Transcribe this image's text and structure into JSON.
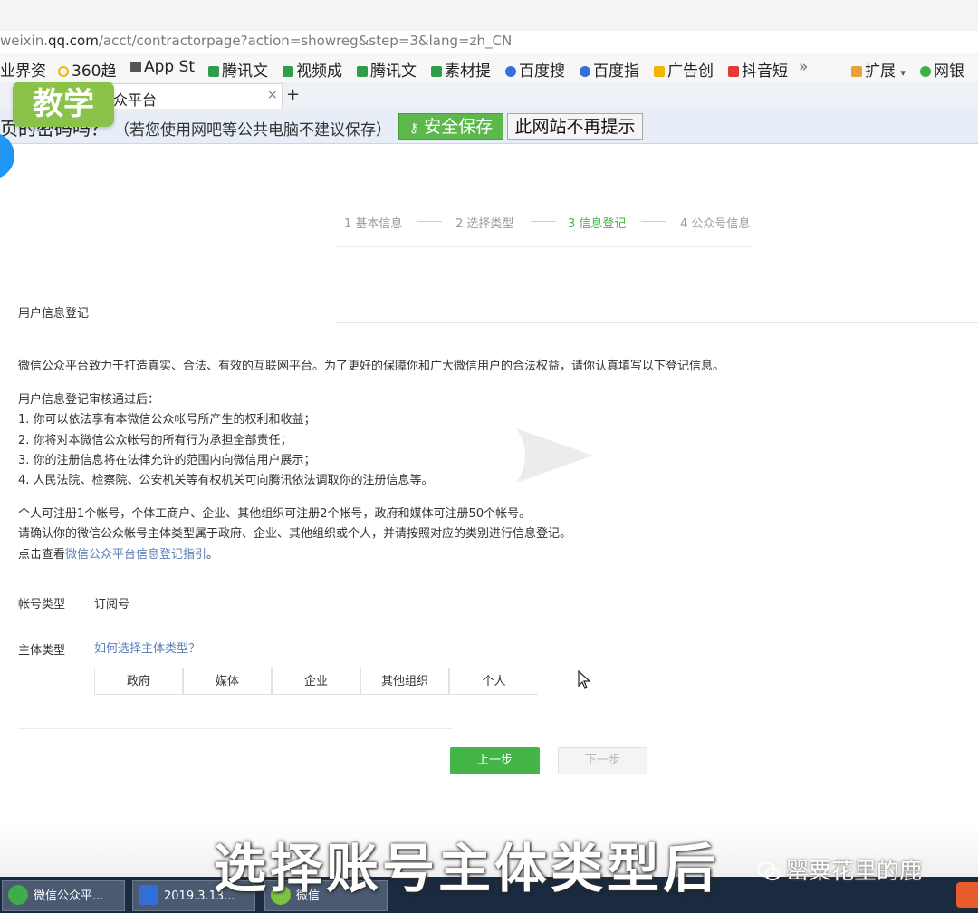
{
  "browser": {
    "url_prefix": "weixin.",
    "url_domain": "qq.com",
    "url_path": "/acct/contractorpage?action=showreg&step=3&lang=zh_CN",
    "bookmarks": [
      {
        "label": "业界资",
        "icon": "folder-icon",
        "color": "#f5b400"
      },
      {
        "label": "360趋",
        "icon": "360-icon",
        "color": "#f5b400"
      },
      {
        "label": "App St",
        "icon": "app-icon",
        "color": "#555555"
      },
      {
        "label": "腾讯文",
        "icon": "doc-icon",
        "color": "#2e9e4a"
      },
      {
        "label": "视频成",
        "icon": "doc-icon",
        "color": "#2e9e4a"
      },
      {
        "label": "腾讯文",
        "icon": "doc-icon",
        "color": "#2e9e4a"
      },
      {
        "label": "素材提",
        "icon": "doc-icon",
        "color": "#2e9e4a"
      },
      {
        "label": "百度搜",
        "icon": "baidu-icon",
        "color": "#3a6fd8"
      },
      {
        "label": "百度指",
        "icon": "baidu-icon",
        "color": "#3a6fd8"
      },
      {
        "label": "广告创",
        "icon": "folder-icon",
        "color": "#f5b400"
      },
      {
        "label": "抖音短",
        "icon": "folder-icon",
        "color": "#e53935"
      }
    ],
    "bookmarks_more": "»",
    "extensions_label": "扩展",
    "bank_label": "网银",
    "tab_title": "众平台",
    "tab_close": "×",
    "tab_add": "+"
  },
  "badge": {
    "label": "教学"
  },
  "password_bar": {
    "question": "页的密码吗？",
    "note": "（若您使用网吧等公共电脑不建议保存）",
    "save_label": "安全保存",
    "never_label": "此网站不再提示"
  },
  "steps": [
    {
      "label": "1 基本信息",
      "active": false
    },
    {
      "label": "2 选择类型",
      "active": false
    },
    {
      "label": "3 信息登记",
      "active": true
    },
    {
      "label": "4 公众号信息",
      "active": false
    }
  ],
  "form": {
    "section_title": "用户信息登记",
    "intro": "微信公众平台致力于打造真实、合法、有效的互联网平台。为了更好的保障你和广大微信用户的合法权益，请你认真填写以下登记信息。",
    "after_title": "用户信息登记审核通过后：",
    "after_items": [
      "1. 你可以依法享有本微信公众帐号所产生的权利和收益；",
      "2. 你将对本微信公众帐号的所有行为承担全部责任；",
      "3. 你的注册信息将在法律允许的范围内向微信用户展示；",
      "4. 人民法院、检察院、公安机关等有权机关可向腾讯依法调取你的注册信息等。"
    ],
    "limit_text": "个人可注册1个帐号，个体工商户、企业、其他组织可注册2个帐号，政府和媒体可注册50个帐号。",
    "confirm_text": "请确认你的微信公众帐号主体类型属于政府、企业、其他组织或个人，并请按照对应的类别进行信息登记。",
    "guide_prefix": "点击查看",
    "guide_link": "微信公众平台信息登记指引",
    "guide_suffix": "。",
    "account_type_label": "帐号类型",
    "account_type_value": "订阅号",
    "subject_type_label": "主体类型",
    "subject_help_link": "如何选择主体类型？",
    "subject_options": [
      "政府",
      "媒体",
      "企业",
      "其他组织",
      "个人"
    ],
    "prev_label": "上一步",
    "next_label": "下一步"
  },
  "caption": "选择账号主体类型后",
  "watermark": "罂粟花里的鹿",
  "taskbar": [
    {
      "label": "微信公众平...",
      "icon": "ie-icon",
      "color": "#3fae49"
    },
    {
      "label": "2019.3.13...",
      "icon": "video-editor-icon",
      "color": "#2f6fd6"
    },
    {
      "label": "微信",
      "icon": "wechat-icon",
      "color": "#7cc243"
    }
  ],
  "colors": {
    "accent": "#44b549",
    "link": "#5b7fb8",
    "badge": "#8bc34a"
  }
}
